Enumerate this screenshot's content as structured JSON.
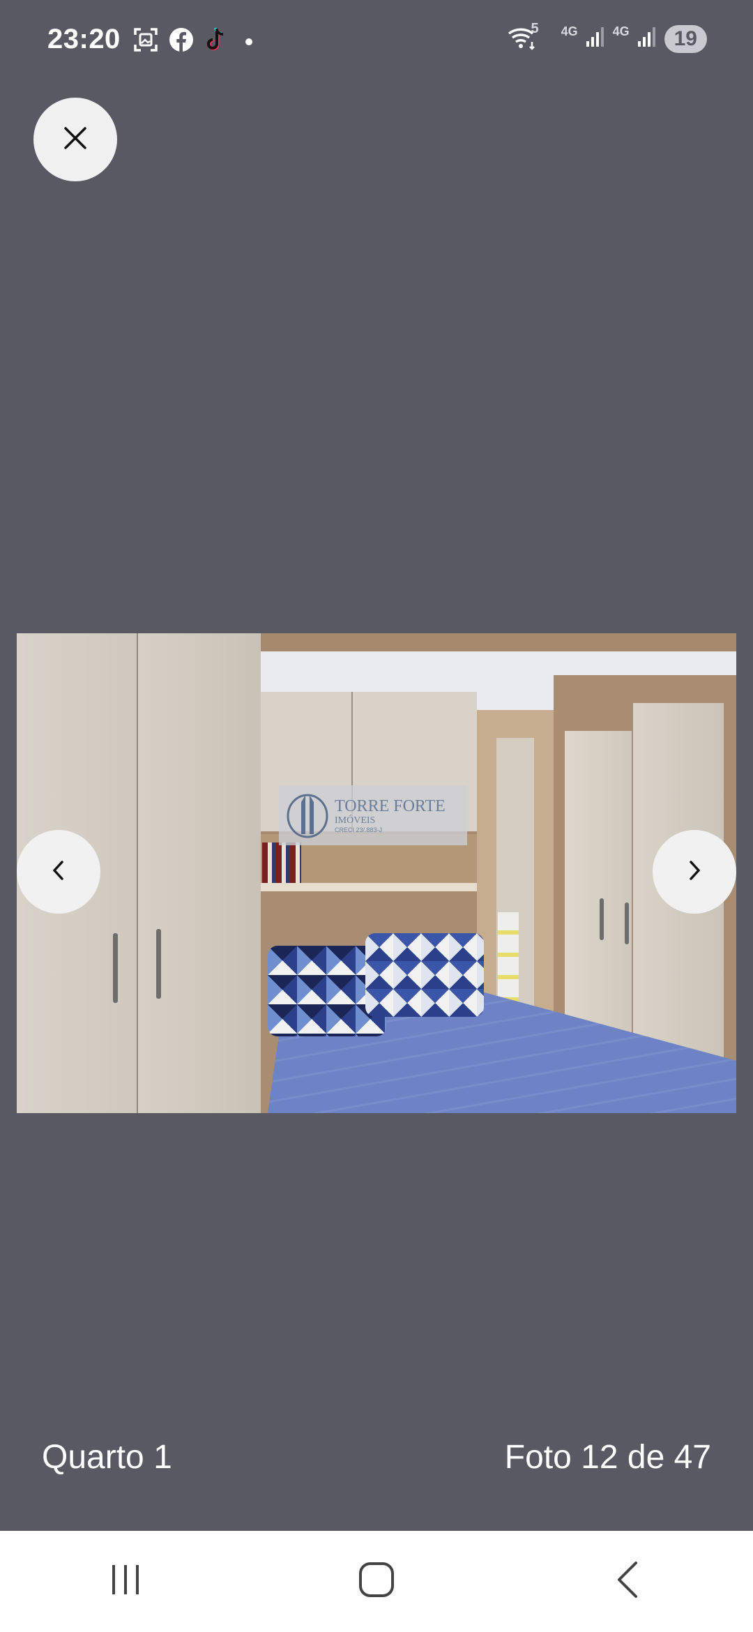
{
  "status_bar": {
    "time": "23:20",
    "left_icons": [
      "screenshot-icon",
      "facebook-icon",
      "tiktok-icon"
    ],
    "network_1": "4G",
    "network_2": "4G",
    "wifi_label": "5",
    "battery": "19"
  },
  "viewer": {
    "close_icon": "close-icon",
    "prev_icon": "chevron-left-icon",
    "next_icon": "chevron-right-icon"
  },
  "photo": {
    "watermark_brand": "TORRE FORTE",
    "watermark_sub": "IMÓVEIS",
    "watermark_tiny": "CRECI 23/.883-J"
  },
  "footer": {
    "caption": "Quarto 1",
    "counter": "Foto 12 de 47"
  },
  "system_nav": {
    "recent_icon": "recent-apps-icon",
    "home_icon": "home-icon",
    "back_icon": "back-icon"
  },
  "colors": {
    "background": "#595964",
    "button_bg": "#f1f1f1",
    "text": "#ffffff"
  }
}
